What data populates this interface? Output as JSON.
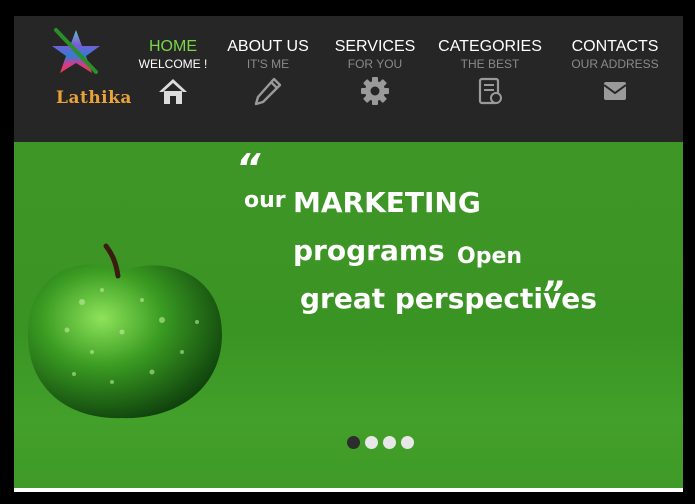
{
  "brand": {
    "name": "Lathika"
  },
  "nav": [
    {
      "title": "HOME",
      "subtitle": "WELCOME !",
      "icon": "home-icon",
      "active": true
    },
    {
      "title": "ABOUT US",
      "subtitle": "IT'S ME",
      "icon": "pencil-icon",
      "active": false
    },
    {
      "title": "SERVICES",
      "subtitle": "FOR YOU",
      "icon": "gear-icon",
      "active": false
    },
    {
      "title": "CATEGORIES",
      "subtitle": "THE BEST",
      "icon": "document-icon",
      "active": false
    },
    {
      "title": "CONTACTS",
      "subtitle": "OUR ADDRESS",
      "icon": "envelope-icon",
      "active": false
    }
  ],
  "hero": {
    "quote_open": "“",
    "word_our": "our",
    "word_marketing": "MARKETING",
    "word_programs": "programs",
    "word_open": "Open",
    "word_perspectives": "great perspectives",
    "quote_close": "”"
  },
  "slider": {
    "count": 4,
    "active_index": 0
  },
  "colors": {
    "header_bg": "#262626",
    "hero_green": "#3e9626",
    "active_nav": "#79d64a",
    "logo_text": "#e8a23a"
  }
}
